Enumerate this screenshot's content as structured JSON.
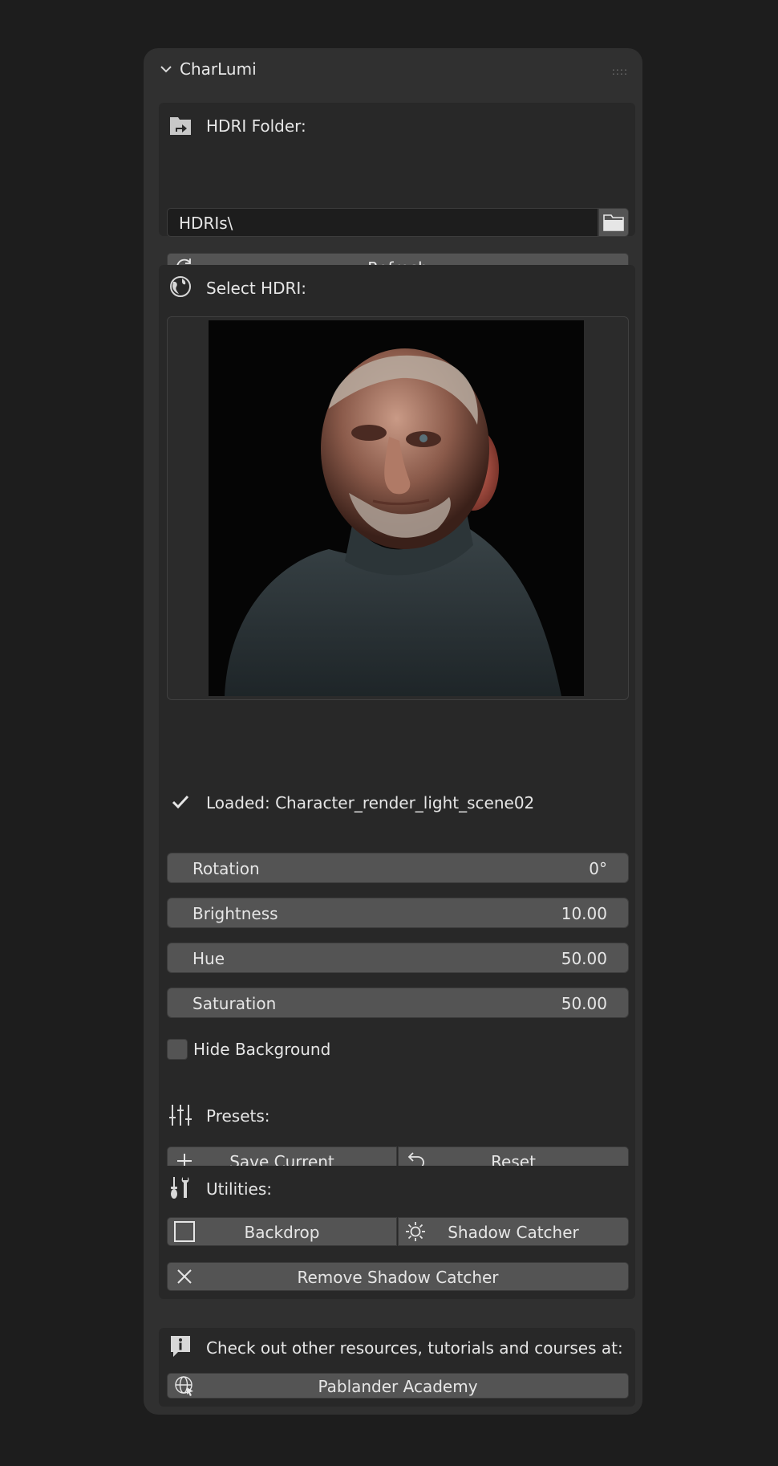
{
  "panel": {
    "title": "CharLumi"
  },
  "hdri_folder": {
    "heading": "HDRI Folder:",
    "path_value": "HDRIs\\",
    "refresh_label": "Refresh"
  },
  "select_hdri": {
    "heading": "Select HDRI:",
    "loaded_text": "Loaded: Character_render_light_scene02"
  },
  "sliders": [
    {
      "label": "Rotation",
      "value": "0°"
    },
    {
      "label": "Brightness",
      "value": "10.00"
    },
    {
      "label": "Hue",
      "value": "50.00"
    },
    {
      "label": "Saturation",
      "value": "50.00"
    }
  ],
  "hide_background": {
    "label": "Hide Background",
    "checked": false
  },
  "presets": {
    "heading": "Presets:",
    "save_label": "Save Current",
    "reset_label": "Reset"
  },
  "utilities": {
    "heading": "Utilities:",
    "backdrop_label": "Backdrop",
    "shadow_catcher_label": "Shadow Catcher",
    "remove_shadow_label": "Remove Shadow Catcher"
  },
  "resources": {
    "text": "Check out other resources, tutorials and courses at:",
    "link_label": "Pablander Academy"
  }
}
